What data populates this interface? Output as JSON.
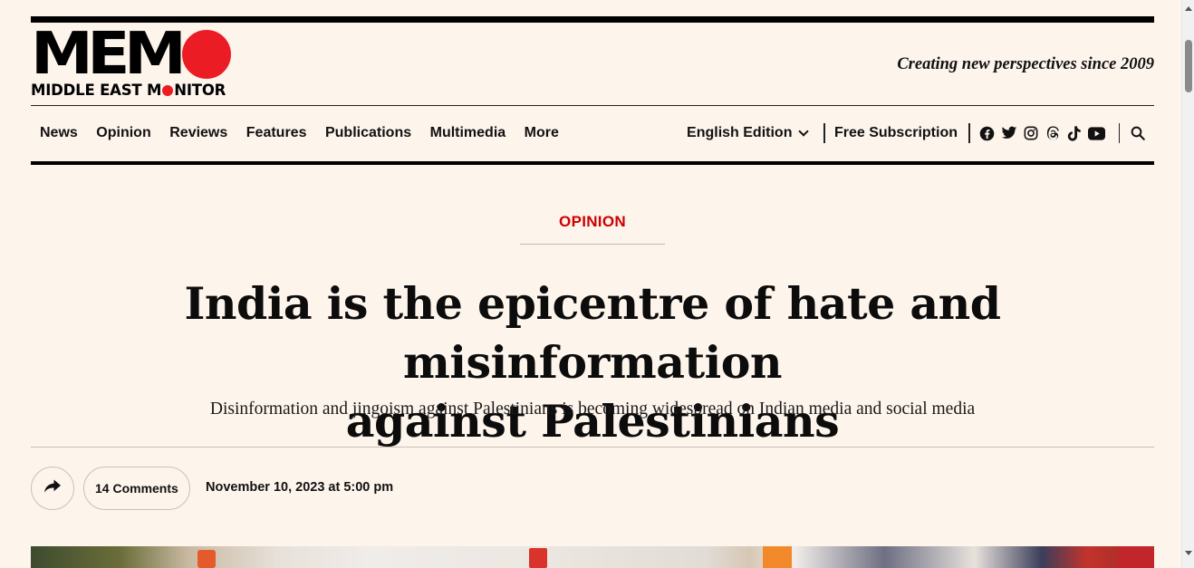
{
  "header": {
    "logo_word": "MEM",
    "logo_subtitle_pre": "MIDDLE EAST M",
    "logo_subtitle_post": "NITOR",
    "tagline": "Creating new perspectives since 2009"
  },
  "nav": {
    "items": [
      "News",
      "Opinion",
      "Reviews",
      "Features",
      "Publications",
      "Multimedia",
      "More"
    ],
    "edition_label": "English Edition",
    "subscription_label": "Free Subscription",
    "social_icons": [
      "facebook-icon",
      "twitter-icon",
      "instagram-icon",
      "threads-icon",
      "tiktok-icon",
      "youtube-icon"
    ]
  },
  "article": {
    "category": "OPINION",
    "headline_line1": "India is the epicentre of hate and misinformation",
    "headline_line2": "against Palestinians",
    "subheadline": "Disinformation and jingoism against Palestinians is becoming widespread on Indian media and social media",
    "comments_label": "14 Comments",
    "published": "November 10, 2023 at 5:00 pm"
  },
  "colors": {
    "background": "#fdf4ec",
    "accent_red": "#ec1c24",
    "category_red": "#cc0000"
  }
}
